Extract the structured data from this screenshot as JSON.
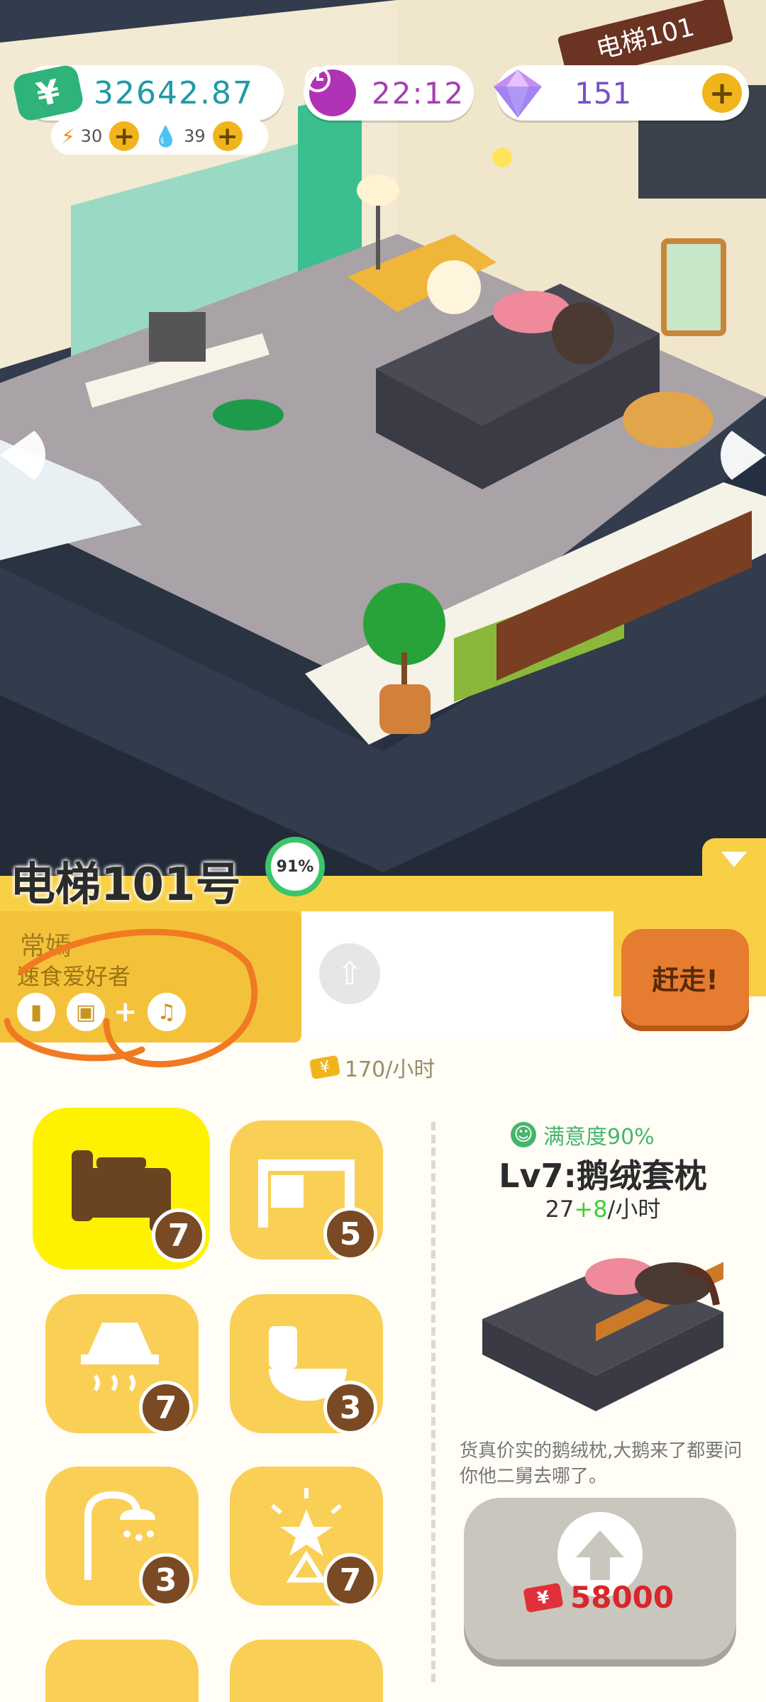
{
  "hud": {
    "money": "32642.87",
    "energy": "30",
    "water": "39",
    "time": "22:12",
    "gems": "151",
    "money_icon": "yen-icon",
    "time_icon": "clock-icon",
    "gem_icon": "diamond-icon",
    "plus_icon": "plus-icon"
  },
  "scene": {
    "elevator_sign": "电梯101"
  },
  "panel": {
    "room_title": "电梯101号",
    "occupancy": "91%",
    "tenant_name": "常嫣",
    "tenant_trait": "速食爱好者",
    "pref_icons": [
      "cup-icon",
      "box-icon",
      "music-icon"
    ],
    "pref_plus": "+",
    "evict_label": "赶走!",
    "income": "170/小时",
    "income_icon": "yen-icon"
  },
  "categories": [
    {
      "name": "bed",
      "level": "7",
      "selected": true
    },
    {
      "name": "desk",
      "level": "5",
      "selected": false
    },
    {
      "name": "range-hood",
      "level": "7",
      "selected": false
    },
    {
      "name": "toilet",
      "level": "3",
      "selected": false
    },
    {
      "name": "shower",
      "level": "3",
      "selected": false
    },
    {
      "name": "lamp",
      "level": "7",
      "selected": false
    }
  ],
  "item": {
    "satisfaction": "满意度90%",
    "name": "Lv7:鹅绒套枕",
    "rate_base": "27",
    "rate_bonus": "+8",
    "rate_unit": "/小时",
    "description": "货真价实的鹅绒枕,大鹅来了都要问你他二舅去哪了。",
    "price": "58000"
  },
  "colors": {
    "panel_yellow": "#f8d046",
    "money_green": "#2fb37a",
    "time_purple": "#a43fb0",
    "evict_orange": "#e67c30",
    "price_red": "#d8262b"
  }
}
